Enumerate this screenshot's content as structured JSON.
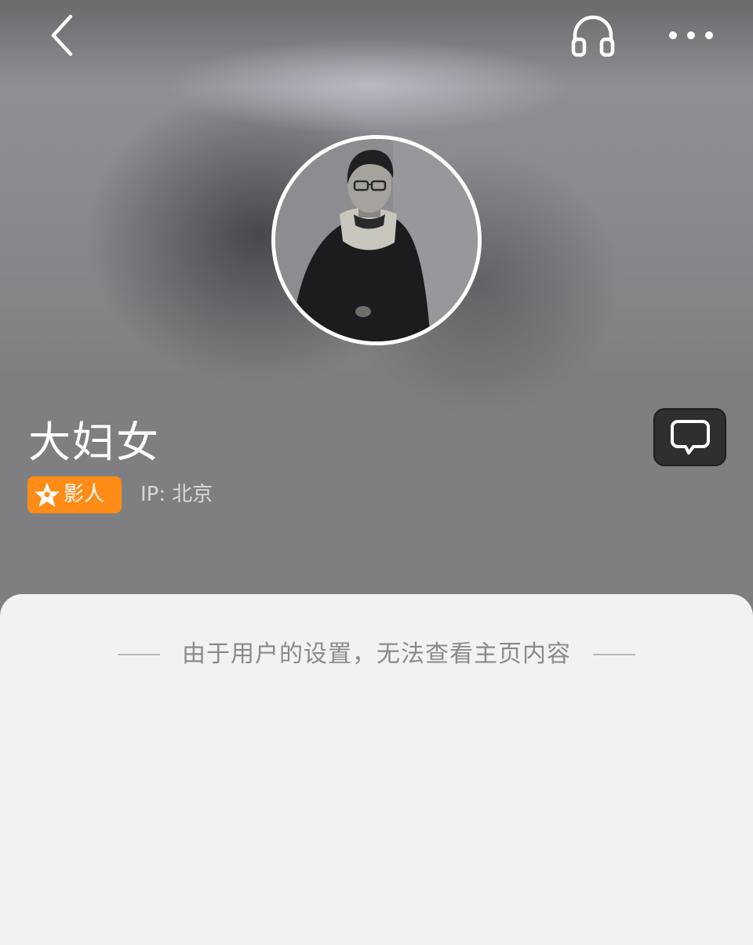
{
  "header": {
    "back_icon": "chevron-left-icon",
    "listen_icon": "headphones-icon",
    "more_icon": "more-dots-icon"
  },
  "profile": {
    "name": "大妇女",
    "badge": {
      "icon": "star-person-icon",
      "label": "影人",
      "color": "#ff8c16"
    },
    "ip_label": "IP:",
    "ip_location": "北京",
    "message_icon": "speech-bubble-icon"
  },
  "content": {
    "notice": "由于用户的设置，无法查看主页内容"
  }
}
